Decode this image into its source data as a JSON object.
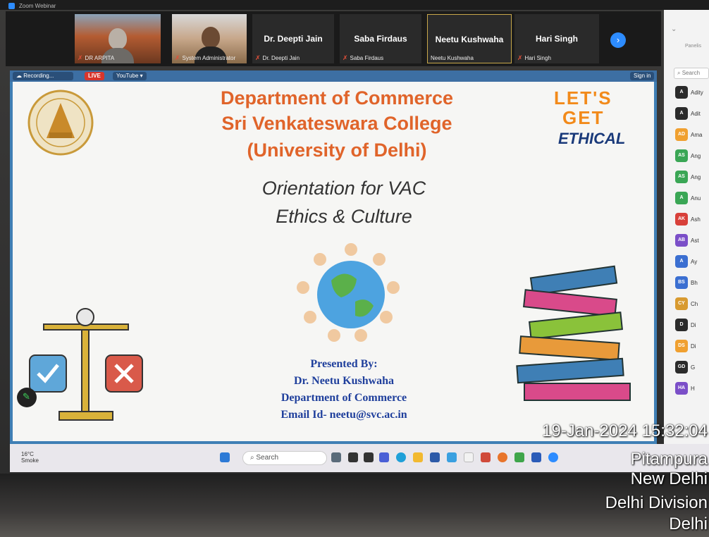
{
  "window": {
    "title": "Zoom Webinar"
  },
  "participants": [
    {
      "display_name": "",
      "caption": "DR ARPITA",
      "muted": true,
      "video": true
    },
    {
      "display_name": "",
      "caption": "System Administrator",
      "muted": true,
      "video": true
    },
    {
      "display_name": "Dr. Deepti Jain",
      "caption": "Dr. Deepti Jain",
      "muted": true,
      "video": false
    },
    {
      "display_name": "Saba Firdaus",
      "caption": "Saba Firdaus",
      "muted": true,
      "video": false
    },
    {
      "display_name": "Neetu Kushwaha",
      "caption": "Neetu Kushwaha",
      "muted": false,
      "video": false,
      "active_speaker": true
    },
    {
      "display_name": "Hari Singh",
      "caption": "Hari Singh",
      "muted": true,
      "video": false
    }
  ],
  "share_toolbar": {
    "recording_label": "Recording...",
    "live_label": "LIVE",
    "youtube_label": "YouTube",
    "sign_in_label": "Sign in"
  },
  "slide": {
    "title_line1": "Department of Commerce",
    "title_line2": "Sri Venkateswara College",
    "title_line3": "(University of Delhi)",
    "subtitle_line1": "Orientation for VAC",
    "subtitle_line2": "Ethics & Culture",
    "presented_by": "Presented By:",
    "presenter": "Dr. Neetu Kushwaha",
    "presenter_dept": "Department of Commerce",
    "email": "Email Id- neetu@svc.ac.in",
    "lets_get_1": "LET'S",
    "lets_get_2": "GET",
    "lets_get_3": "ETHICAL"
  },
  "side_panel": {
    "tab_label": "Panelis",
    "search_placeholder": "Search",
    "attendees": [
      {
        "initials": "A",
        "name": "Adity",
        "color": "#2b2b2b"
      },
      {
        "initials": "A",
        "name": "Adit",
        "color": "#2b2b2b"
      },
      {
        "initials": "AD",
        "name": "Ama",
        "color": "#f0a030"
      },
      {
        "initials": "AS",
        "name": "Ang",
        "color": "#3aa655"
      },
      {
        "initials": "AS",
        "name": "Ang",
        "color": "#3aa655"
      },
      {
        "initials": "A",
        "name": "Anu",
        "color": "#3aa655"
      },
      {
        "initials": "AK",
        "name": "Ash",
        "color": "#d8403a"
      },
      {
        "initials": "AB",
        "name": "Ast",
        "color": "#7b4fc8"
      },
      {
        "initials": "A",
        "name": "Ay",
        "color": "#3b6fd1"
      },
      {
        "initials": "BS",
        "name": "Bh",
        "color": "#3b6fd1"
      },
      {
        "initials": "CY",
        "name": "Ch",
        "color": "#d89a30"
      },
      {
        "initials": "D",
        "name": "Di",
        "color": "#2b2b2b"
      },
      {
        "initials": "DS",
        "name": "Di",
        "color": "#f0a030"
      },
      {
        "initials": "GD",
        "name": "G",
        "color": "#2b2b2b"
      },
      {
        "initials": "HA",
        "name": "H",
        "color": "#7b4fc8"
      }
    ]
  },
  "taskbar": {
    "temperature": "16°C",
    "weather": "Smoke",
    "search_placeholder": "Search"
  },
  "photo_stamp": {
    "datetime": "19-Jan-2024 15:32:04",
    "line2": "Pitampura",
    "line3": "New Delhi",
    "line4": "Delhi Division",
    "line5": "Delhi"
  }
}
